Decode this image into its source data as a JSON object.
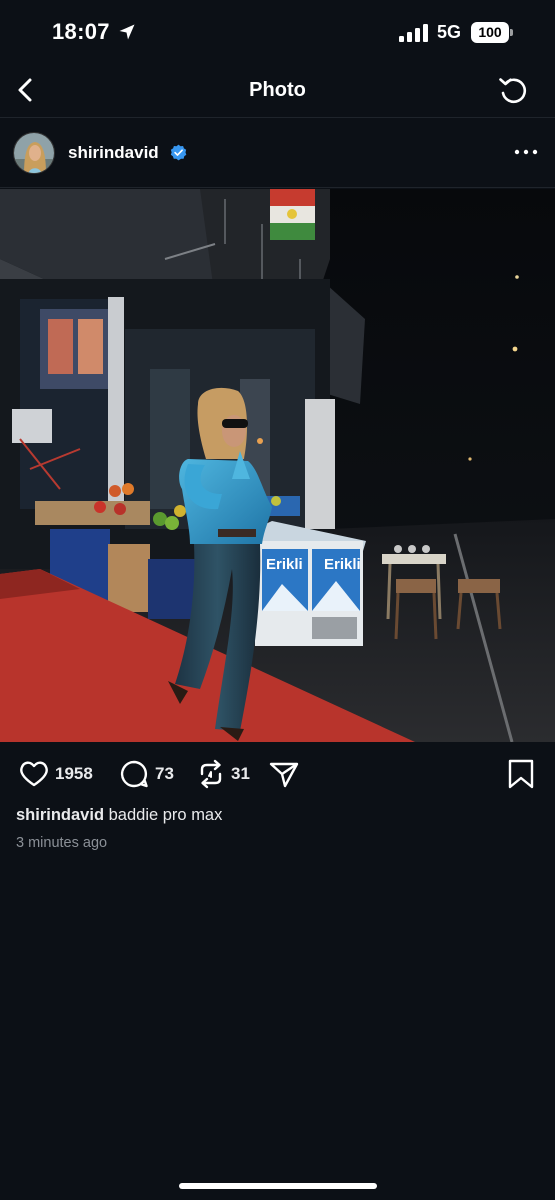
{
  "status_bar": {
    "time": "18:07",
    "network": "5G",
    "battery": "100",
    "icons": [
      "location-arrow-icon",
      "signal-bars-icon",
      "battery-icon"
    ]
  },
  "nav": {
    "title": "Photo",
    "icons": [
      "chevron-left-icon",
      "refresh-icon"
    ]
  },
  "post": {
    "author": "shirindavid",
    "verified": true,
    "caption_user": "shirindavid",
    "caption_text": "baddie pro max",
    "timestamp": "3 minutes ago",
    "photo_sign_text": "Erikli",
    "accent_color": "#3897f0",
    "stats": {
      "likes": "1958",
      "comments": "73",
      "reposts": "31"
    },
    "icons": [
      "heart-icon",
      "comment-bubble-icon",
      "repost-icon",
      "share-send-icon",
      "bookmark-icon",
      "more-dots-icon",
      "verified-badge-icon"
    ]
  }
}
